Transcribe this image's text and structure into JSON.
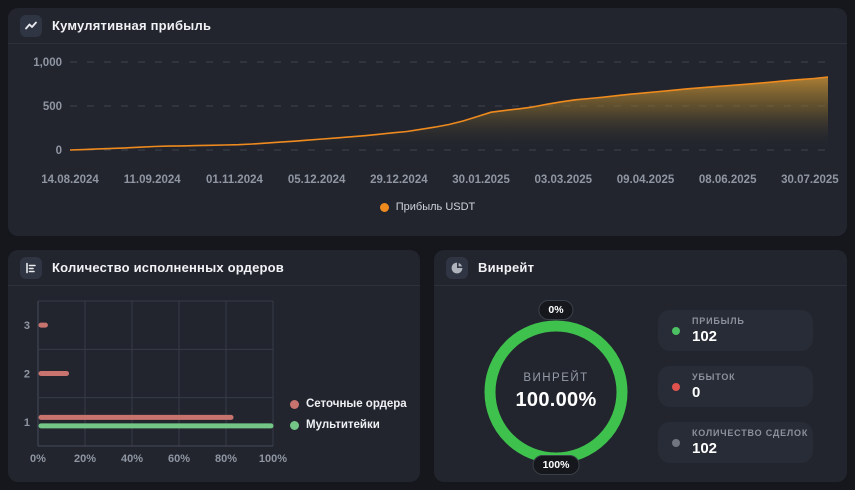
{
  "colors": {
    "page_bg": "#15171c",
    "panel_bg": "#22252e",
    "orange": "#ee8a1e",
    "green": "#3ec24d",
    "bar_red": "#c9736f",
    "bar_green": "#74c687",
    "axis_text": "#8f96a2"
  },
  "panels": {
    "cumulative": {
      "title": "Кумулятивная прибыль",
      "legend_label": "Прибыль USDT"
    },
    "orders": {
      "title": "Количество исполненных ордеров",
      "legend": [
        {
          "label": "Сеточные ордера",
          "color": "#c9736f"
        },
        {
          "label": "Мультитейки",
          "color": "#74c687"
        }
      ]
    },
    "winrate": {
      "title": "Винрейт",
      "badge_top": "0%",
      "badge_bottom": "100%",
      "center_label": "ВИНРЕЙТ",
      "center_value": "100.00%",
      "stats": [
        {
          "label": "ПРИБЫЛЬ",
          "value": "102",
          "dot_color": "#4cc164"
        },
        {
          "label": "УБЫТОК",
          "value": "0",
          "dot_color": "#e0524e"
        },
        {
          "label": "КОЛИЧЕСТВО СДЕЛОК",
          "value": "102",
          "dot_color": "#70757e"
        }
      ]
    }
  },
  "chart_data": [
    {
      "id": "cumulative_profit",
      "type": "area",
      "title": "Кумулятивная прибыль",
      "xlabel": "",
      "ylabel": "",
      "x_ticks": [
        "14.08.2024",
        "11.09.2024",
        "01.11.2024",
        "05.12.2024",
        "29.12.2024",
        "30.01.2025",
        "03.03.2025",
        "09.04.2025",
        "08.06.2025",
        "30.07.2025"
      ],
      "y_ticks": [
        {
          "label": "1,000",
          "value": 1000
        },
        {
          "label": "500",
          "value": 500
        },
        {
          "label": "0",
          "value": 0
        }
      ],
      "ylim": [
        0,
        1000
      ],
      "grid": "horizontal-dashed",
      "legend_position": "bottom",
      "series": [
        {
          "name": "Прибыль USDT",
          "color": "#ee8a1e",
          "values": [
            0,
            5,
            12,
            18,
            24,
            32,
            40,
            44,
            47,
            50,
            53,
            57,
            60,
            68,
            78,
            90,
            100,
            112,
            125,
            138,
            150,
            163,
            178,
            195,
            210,
            235,
            260,
            290,
            330,
            380,
            430,
            450,
            468,
            490,
            520,
            548,
            570,
            585,
            600,
            618,
            635,
            650,
            665,
            680,
            695,
            708,
            720,
            733,
            745,
            758,
            772,
            788,
            800,
            812,
            830
          ]
        }
      ],
      "area_gradient": [
        {
          "offset": 0,
          "color": "#e7a43c",
          "opacity": 0.95
        },
        {
          "offset": 0.55,
          "color": "#8a6d2c",
          "opacity": 0.5
        },
        {
          "offset": 1,
          "color": "#22252e",
          "opacity": 0
        }
      ]
    },
    {
      "id": "executed_orders",
      "type": "bar",
      "orientation": "horizontal",
      "title": "Количество исполненных ордеров",
      "categories": [
        "3",
        "2",
        "1"
      ],
      "x_ticks": [
        {
          "label": "0%",
          "value": 0
        },
        {
          "label": "20%",
          "value": 20
        },
        {
          "label": "40%",
          "value": 40
        },
        {
          "label": "60%",
          "value": 60
        },
        {
          "label": "80%",
          "value": 80
        },
        {
          "label": "100%",
          "value": 100
        }
      ],
      "xlim": [
        0,
        100
      ],
      "grid": "both-solid",
      "legend_position": "right",
      "series": [
        {
          "name": "Сеточные ордера",
          "color": "#c9736f",
          "values": [
            4,
            13,
            83
          ]
        },
        {
          "name": "Мультитейки",
          "color": "#74c687",
          "values": [
            null,
            null,
            100
          ]
        }
      ]
    },
    {
      "id": "winrate",
      "type": "donut",
      "title": "Винрейт",
      "value": 100,
      "display_value": "100.00%",
      "center_label": "ВИНРЕЙТ",
      "color": "#3ec24d",
      "scale_badges": [
        "0%",
        "100%"
      ]
    }
  ]
}
